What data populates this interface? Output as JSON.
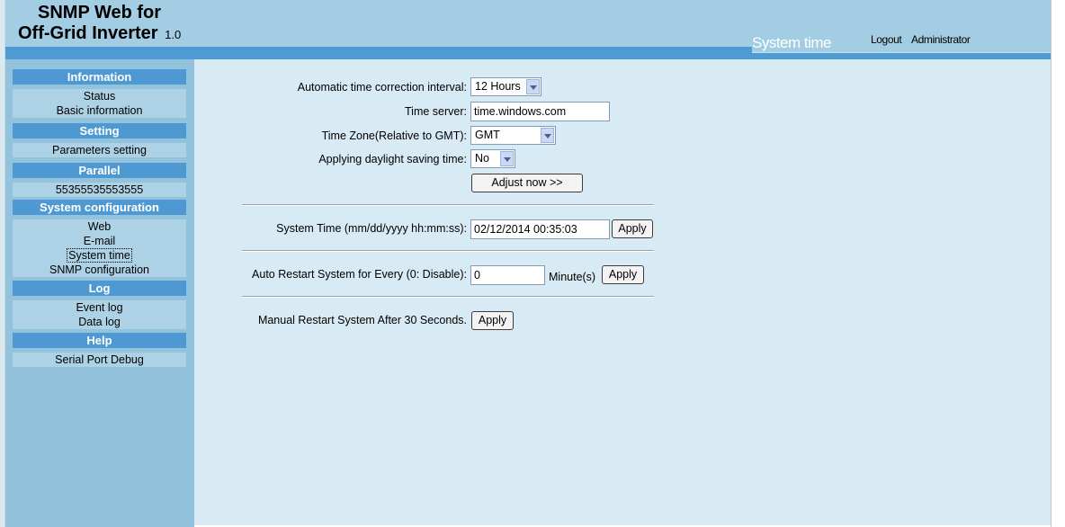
{
  "header": {
    "title_line1": "SNMP Web for",
    "title_line2": "Off-Grid Inverter",
    "version": "1.0",
    "page_heading": "System time",
    "logout": "Logout",
    "user": "Administrator"
  },
  "sidebar": {
    "information": {
      "heading": "Information",
      "items": [
        "Status",
        "Basic information"
      ]
    },
    "setting": {
      "heading": "Setting",
      "items": [
        "Parameters setting"
      ]
    },
    "parallel": {
      "heading": "Parallel",
      "items": [
        "55355535553555"
      ]
    },
    "system_configuration": {
      "heading": "System configuration",
      "items": [
        "Web",
        "E-mail",
        "System time",
        "SNMP configuration"
      ]
    },
    "log": {
      "heading": "Log",
      "items": [
        "Event log",
        "Data log"
      ]
    },
    "help": {
      "heading": "Help",
      "items": [
        "Serial Port Debug"
      ]
    }
  },
  "form": {
    "interval_label": "Automatic time correction interval:",
    "interval_value": "12 Hours",
    "server_label": "Time server:",
    "server_value": "time.windows.com",
    "timezone_label": "Time Zone(Relative to GMT):",
    "timezone_value": "GMT",
    "dst_label": "Applying daylight saving time:",
    "dst_value": "No",
    "adjust_button": "Adjust now >>",
    "system_time_label": "System Time (mm/dd/yyyy hh:mm:ss):",
    "system_time_value": "02/12/2014 00:35:03",
    "apply_label": "Apply",
    "auto_restart_label": "Auto Restart System for Every (0: Disable):",
    "auto_restart_value": "0",
    "minutes_unit": "Minute(s)",
    "manual_restart_label": "Manual Restart System After 30 Seconds."
  }
}
